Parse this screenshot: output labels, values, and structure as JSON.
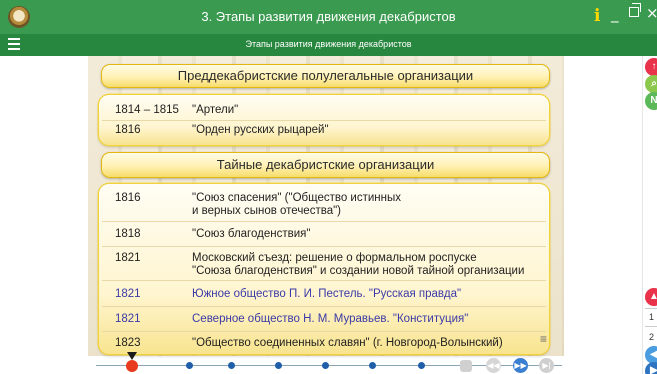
{
  "window": {
    "title": "3. Этапы развития движения декабристов",
    "info_label": "i",
    "minimize_label": "_",
    "close_label": "×"
  },
  "subbar": {
    "title": "Этапы развития движения декабристов"
  },
  "section1": {
    "header": "Преддекабристские полулегальные организации",
    "rows": [
      {
        "year": "1814 – 1815",
        "text": "\"Артели\""
      },
      {
        "year": "1816",
        "text": "\"Орден русских рыцарей\""
      }
    ]
  },
  "section2": {
    "header": "Тайные декабристские организации",
    "rows": [
      {
        "year": "1816",
        "line1": "\"Союз спасения\" (\"Общество истинных",
        "line2": "и верных сынов отечества\")"
      },
      {
        "year": "1818",
        "line1": "\"Союз благоденствия\""
      },
      {
        "year": "1821",
        "line1": "Московский съезд: решение о формальном роспуске",
        "line2": "\"Союза благоденствия\" и создании новой тайной организации"
      },
      {
        "year": "1821",
        "line1": "Южное общество П. И. Пестель. \"Русская правда\""
      },
      {
        "year": "1821",
        "line1": "Северное общество Н. М. Муравьев. \"Конституция\""
      },
      {
        "year": "1823",
        "line1": "\"Общество соединенных славян\" (г. Новгород-Волынский)"
      }
    ]
  },
  "sidebar": {
    "page_1": "1",
    "page_2": "2",
    "search_icon": "search-icon",
    "n_label": "N"
  },
  "colors": {
    "titlebar": "#3a9a4f",
    "subbar": "#28873f",
    "highlight_text": "#3a3aa8",
    "header_border": "#e2b810",
    "timeline_active": "#e83a1e"
  }
}
